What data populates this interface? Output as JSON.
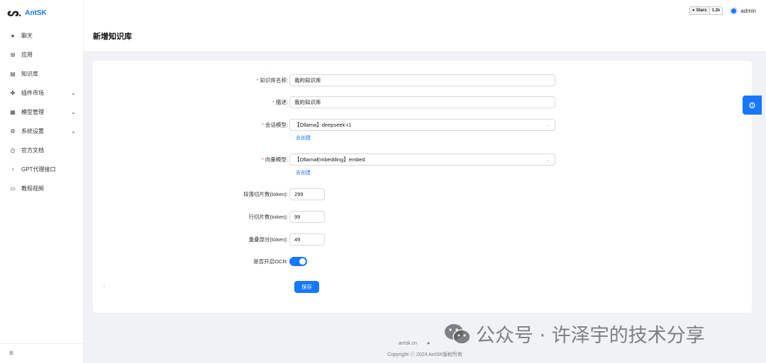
{
  "app": {
    "logo_mark": "ᔕ.",
    "name": "AntSK"
  },
  "sidebar": {
    "items": [
      {
        "icon": "chat-icon",
        "glyph": "●",
        "label": "聊天",
        "chevron": false
      },
      {
        "icon": "apps-icon",
        "glyph": "⊞",
        "label": "应用",
        "chevron": false
      },
      {
        "icon": "book-icon",
        "glyph": "▤",
        "label": "知识库",
        "chevron": false
      },
      {
        "icon": "plugin-icon",
        "glyph": "✤",
        "label": "插件市场",
        "chevron": true
      },
      {
        "icon": "model-icon",
        "glyph": "▦",
        "label": "模型管理",
        "chevron": true
      },
      {
        "icon": "settings-icon",
        "glyph": "⚙",
        "label": "系统设置",
        "chevron": true
      },
      {
        "icon": "docs-icon",
        "glyph": "◷",
        "label": "官方文档",
        "chevron": false
      },
      {
        "icon": "proxy-icon",
        "glyph": "♀",
        "label": "GPT代理接口",
        "chevron": false
      },
      {
        "icon": "video-icon",
        "glyph": "▭",
        "label": "教程视频",
        "chevron": false
      }
    ],
    "footer_glyph": "≡"
  },
  "header": {
    "github": {
      "label": "Stars",
      "count": "1.2k"
    },
    "user": "admin"
  },
  "page": {
    "title": "新增知识库"
  },
  "form": {
    "name": {
      "label": "知识库名称:",
      "value": "我的知识库"
    },
    "desc": {
      "label": "描述:",
      "value": "我的知识库"
    },
    "chat_model": {
      "label": "会话模型:",
      "value": "【Ollama】deepseek-r1",
      "link": "去创建"
    },
    "embed_model": {
      "label": "向量模型:",
      "value": "【OllamaEmbedding】embed",
      "link": "去创建"
    },
    "paragraph_tokens": {
      "label": "段落切片数(token):",
      "value": "299"
    },
    "line_tokens": {
      "label": "行切片数(token):",
      "value": "99"
    },
    "overlap_tokens": {
      "label": "重叠部分(token):",
      "value": "49"
    },
    "ocr": {
      "label": "是否开启OCR:",
      "enabled": true
    },
    "colon": ":",
    "save_label": "保存"
  },
  "footer": {
    "site": "antsk.cn",
    "copyright": "Copyright ⓒ 2024 AntSK版权所有"
  },
  "watermark": {
    "text": "公众号 · 许泽宇的技术分享"
  },
  "colors": {
    "primary": "#1677ff",
    "required": "#ff4d4f"
  }
}
